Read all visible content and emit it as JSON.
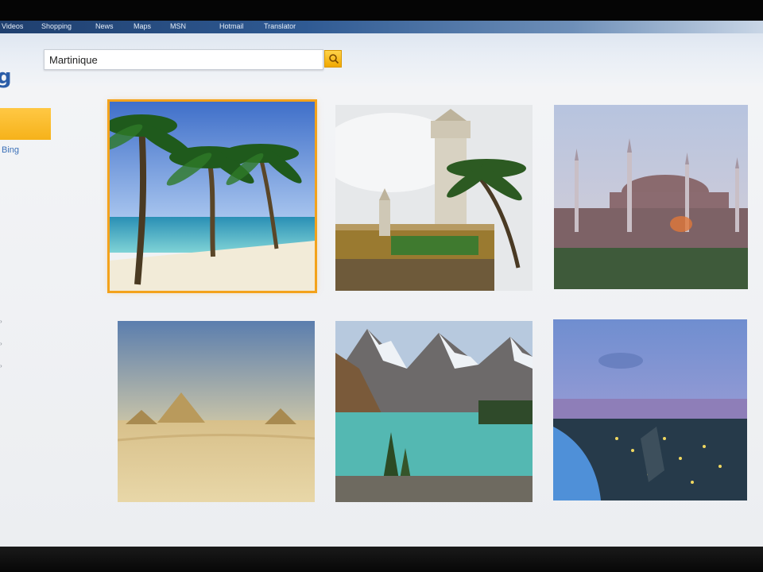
{
  "nav": {
    "items": [
      "Videos",
      "Shopping",
      "News",
      "Maps",
      "MSN",
      "Hotmail",
      "Translator"
    ]
  },
  "search": {
    "value": "Martinique"
  },
  "sidebar": {
    "link_label": "Bing"
  },
  "results": {
    "images": [
      {
        "name": "beach-palm-trees",
        "selected": true
      },
      {
        "name": "mosque-palm-tree",
        "selected": false
      },
      {
        "name": "istanbul-skyline",
        "selected": false
      },
      {
        "name": "desert-pyramids",
        "selected": false
      },
      {
        "name": "mountain-lake",
        "selected": false
      },
      {
        "name": "city-night-bay",
        "selected": false
      }
    ]
  },
  "colors": {
    "accent": "#f3a21b",
    "link": "#3c70b8",
    "nav_bar": "#2f5a93"
  }
}
